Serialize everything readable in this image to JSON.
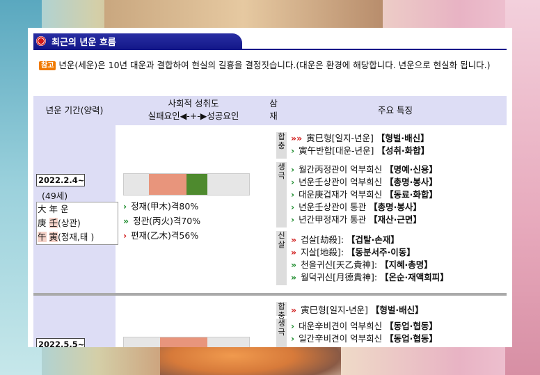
{
  "title": "최근의 년운 흐름",
  "note": {
    "badge": "참고",
    "text": "년운(세운)은 10년 대운과 결합하여 현실의 길흉을 결정짓습니다.(대운은 환경에 해당합니다. 년운으로 현실화 됩니다.)"
  },
  "headers": {
    "period": "년운 기간(양력)",
    "achieve_line1": "사회적 성취도",
    "achieve_line2": "실패요인◀-+-▶성공요인",
    "samjae_line1": "삼",
    "samjae_line2": "재",
    "features": "주요 특징"
  },
  "colors": {
    "head_bg": "#ddddf5",
    "bar_red": "#e8957c",
    "bar_green": "#4e8a2e",
    "arrow_green": "#1a8a2a",
    "arrow_red": "#d01818"
  },
  "rows": [
    {
      "date": "2022.2.4~",
      "age": "(49세)",
      "hanja": [
        {
          "a": "大",
          "b": "年",
          "c": "운"
        },
        {
          "a": "庚",
          "b": "壬",
          "c": "(상관)"
        },
        {
          "a": "午",
          "b": "寅",
          "c": "(정재,태 )"
        }
      ],
      "rates": [
        {
          "arrow": "›",
          "color": "green",
          "text": "정재(甲木)격80%"
        },
        {
          "arrow": "»",
          "color": "green",
          "text": "정관(丙火)격70%"
        },
        {
          "arrow": "›",
          "color": "red",
          "text": "편재(乙木)격56%"
        }
      ],
      "groups": [
        {
          "label": "합충",
          "items": [
            {
              "arrow": "»»",
              "color": "red",
              "text": "寅巳형[일지-년운]",
              "tag": "【형벌·배신】"
            },
            {
              "arrow": "›",
              "color": "green",
              "text": "寅午반합[대운-년운]",
              "tag": "【성취·화합】"
            }
          ]
        },
        {
          "label": "생극",
          "items": [
            {
              "arrow": "›",
              "color": "green",
              "text": "월간丙정관이 억부희신",
              "tag": "【명예·신용】"
            },
            {
              "arrow": "›",
              "color": "green",
              "text": "년운壬상관이 억부희신",
              "tag": "【총명·봉사】"
            },
            {
              "arrow": "›",
              "color": "green",
              "text": "대운庚겁재가 억부희신",
              "tag": "【동료·화합】"
            },
            {
              "arrow": "›",
              "color": "green",
              "text": "년운壬상관이 통관",
              "tag": "【총명·봉사】"
            },
            {
              "arrow": "›",
              "color": "green",
              "text": "년간甲정재가 통관",
              "tag": "【재산·근면】"
            }
          ]
        },
        {
          "label": "신살",
          "items": [
            {
              "arrow": "»",
              "color": "red",
              "text": "겁살[劫殺]:",
              "tag": "【겁탈·손재】"
            },
            {
              "arrow": "»",
              "color": "red",
              "text": "지살[地殺]:",
              "tag": "【동분서주·이동】"
            },
            {
              "arrow": "»",
              "color": "green",
              "text": "천을귀신[天乙貴神]:",
              "tag": "【지혜·총명】"
            },
            {
              "arrow": "»",
              "color": "green",
              "text": "월덕귀신[月德貴神]:",
              "tag": "【온순·재액회피】"
            }
          ]
        }
      ]
    },
    {
      "date": "2022.5.5~",
      "groups": [
        {
          "label": "합충",
          "items": [
            {
              "arrow": "»",
              "color": "red",
              "text": "寅巳형[일지-년운]",
              "tag": "【형벌·배신】"
            }
          ]
        },
        {
          "label": "생극",
          "items": [
            {
              "arrow": "›",
              "color": "green",
              "text": "대운辛비견이 억부희신",
              "tag": "【동업·협동】"
            },
            {
              "arrow": "›",
              "color": "green",
              "text": "일간辛비견이 억부희신",
              "tag": "【동업·협동】"
            }
          ]
        }
      ]
    }
  ]
}
